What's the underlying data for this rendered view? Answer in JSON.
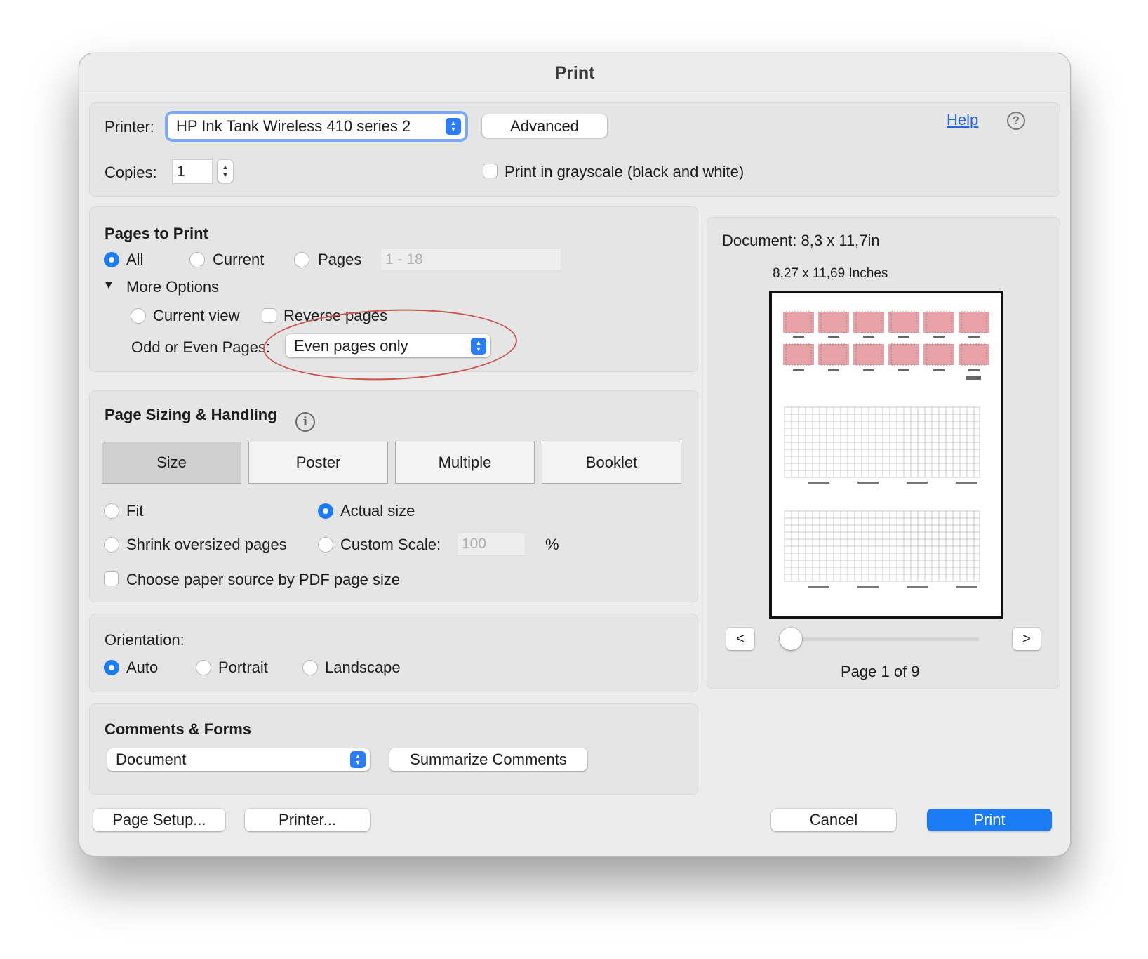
{
  "dialog": {
    "title": "Print"
  },
  "printer_section": {
    "printer_label": "Printer:",
    "printer_value": "HP Ink Tank Wireless 410 series 2",
    "advanced_label": "Advanced",
    "help_label": "Help",
    "help_icon": "question-circle-icon",
    "copies_label": "Copies:",
    "copies_value": "1",
    "grayscale_label": "Print in grayscale (black and white)",
    "grayscale_checked": false
  },
  "pages_to_print": {
    "title": "Pages to Print",
    "options": [
      "All",
      "Current",
      "Pages"
    ],
    "selected": "All",
    "pages_placeholder": "1 - 18",
    "more_options_label": "More Options",
    "current_view_label": "Current view",
    "reverse_pages_label": "Reverse pages",
    "odd_even_label": "Odd or Even Pages:",
    "odd_even_value": "Even pages only"
  },
  "page_sizing": {
    "title": "Page Sizing & Handling",
    "info_icon": "info-circle-icon",
    "tabs": [
      "Size",
      "Poster",
      "Multiple",
      "Booklet"
    ],
    "selected_tab": "Size",
    "fit_label": "Fit",
    "actual_size_label": "Actual size",
    "shrink_label": "Shrink oversized pages",
    "custom_scale_label": "Custom Scale:",
    "custom_scale_value": "100",
    "percent_label": "%",
    "selected_option": "Actual size",
    "paper_source_label": "Choose paper source by PDF page size"
  },
  "orientation": {
    "title": "Orientation:",
    "options": [
      "Auto",
      "Portrait",
      "Landscape"
    ],
    "selected": "Auto"
  },
  "comments_forms": {
    "title": "Comments & Forms",
    "select_value": "Document",
    "summarize_label": "Summarize Comments"
  },
  "preview": {
    "document_size": "Document: 8,3 x 11,7in",
    "paper_size": "8,27 x 11,69 Inches",
    "prev_label": "<",
    "next_label": ">",
    "page_indicator": "Page 1 of 9",
    "slider_position": 0
  },
  "footer": {
    "page_setup_label": "Page Setup...",
    "printer_label": "Printer...",
    "cancel_label": "Cancel",
    "print_label": "Print"
  },
  "colors": {
    "accent": "#1a7cf5",
    "annotation": "#c9554f"
  }
}
